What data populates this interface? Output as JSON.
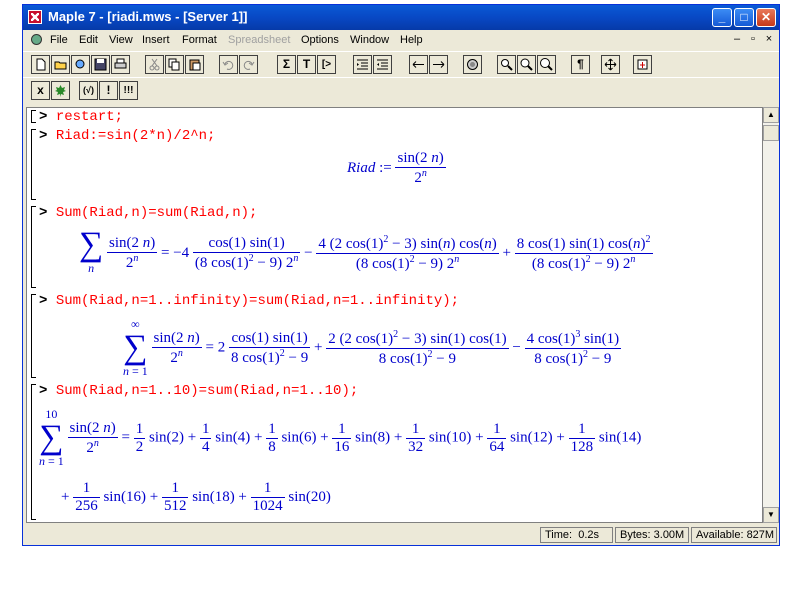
{
  "window": {
    "title": "Maple 7  - [riadi.mws - [Server 1]]",
    "controls": {
      "minimize": "_",
      "maximize": "□",
      "close": "✕"
    }
  },
  "menu": {
    "items": [
      "File",
      "Edit",
      "View",
      "Insert",
      "Format",
      "Spreadsheet",
      "Options",
      "Window",
      "Help"
    ],
    "mdi": {
      "minimize": "–",
      "restore": "▫",
      "close": "×"
    }
  },
  "toolbar": {
    "sigma": "Σ",
    "text": "T",
    "prompt": "[>",
    "paragraph": "¶",
    "exec_x": "x",
    "exec_bang": "!",
    "exec_bang3": "!!!",
    "exec_paren": "(√)"
  },
  "worksheet": {
    "prompts": [
      "restart;",
      "Riad:=sin(2*n)/2^n;",
      "Sum(Riad,n)=sum(Riad,n);",
      "Sum(Riad,n=1..infinity)=sum(Riad,n=1..infinity);",
      "Sum(Riad,n=1..10)=sum(Riad,n=1..10);"
    ],
    "prompt_symbol": ">"
  },
  "status": {
    "time_label": "Time:",
    "time_value": "0.2s",
    "bytes_label": "Bytes:",
    "bytes_value": "3.00M",
    "available_label": "Available:",
    "available_value": "827M"
  }
}
